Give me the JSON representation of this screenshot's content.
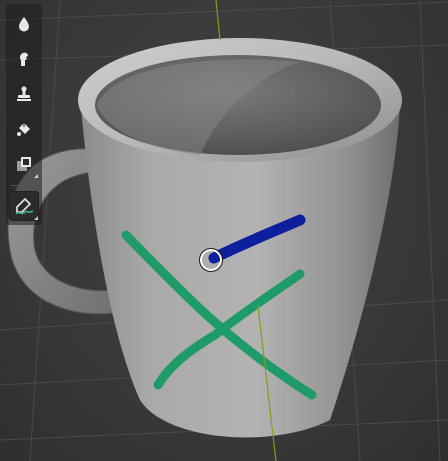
{
  "viewport": {
    "background": "#3a3a3a",
    "grid_color": "#4a4a4a",
    "axis_y_color": "#7fa01e"
  },
  "model": {
    "name": "mug",
    "color": "#a6a6a6"
  },
  "strokes": [
    {
      "name": "green-cross-stroke",
      "color": "#1f9a6a"
    },
    {
      "name": "blue-stroke",
      "color": "#0e1f9e"
    }
  ],
  "brush_cursor": {
    "name": "brush-cursor",
    "color": "#ffffff"
  },
  "toolbar": {
    "tools": [
      {
        "id": "draw",
        "icon": "drop-icon"
      },
      {
        "id": "smear",
        "icon": "smear-icon"
      },
      {
        "id": "clone",
        "icon": "stamp-icon"
      },
      {
        "id": "fill",
        "icon": "paint-bucket-icon"
      },
      {
        "id": "mask",
        "icon": "mask-icon"
      },
      {
        "id": "annotate",
        "icon": "annotate-pen-icon",
        "active": true
      }
    ]
  }
}
